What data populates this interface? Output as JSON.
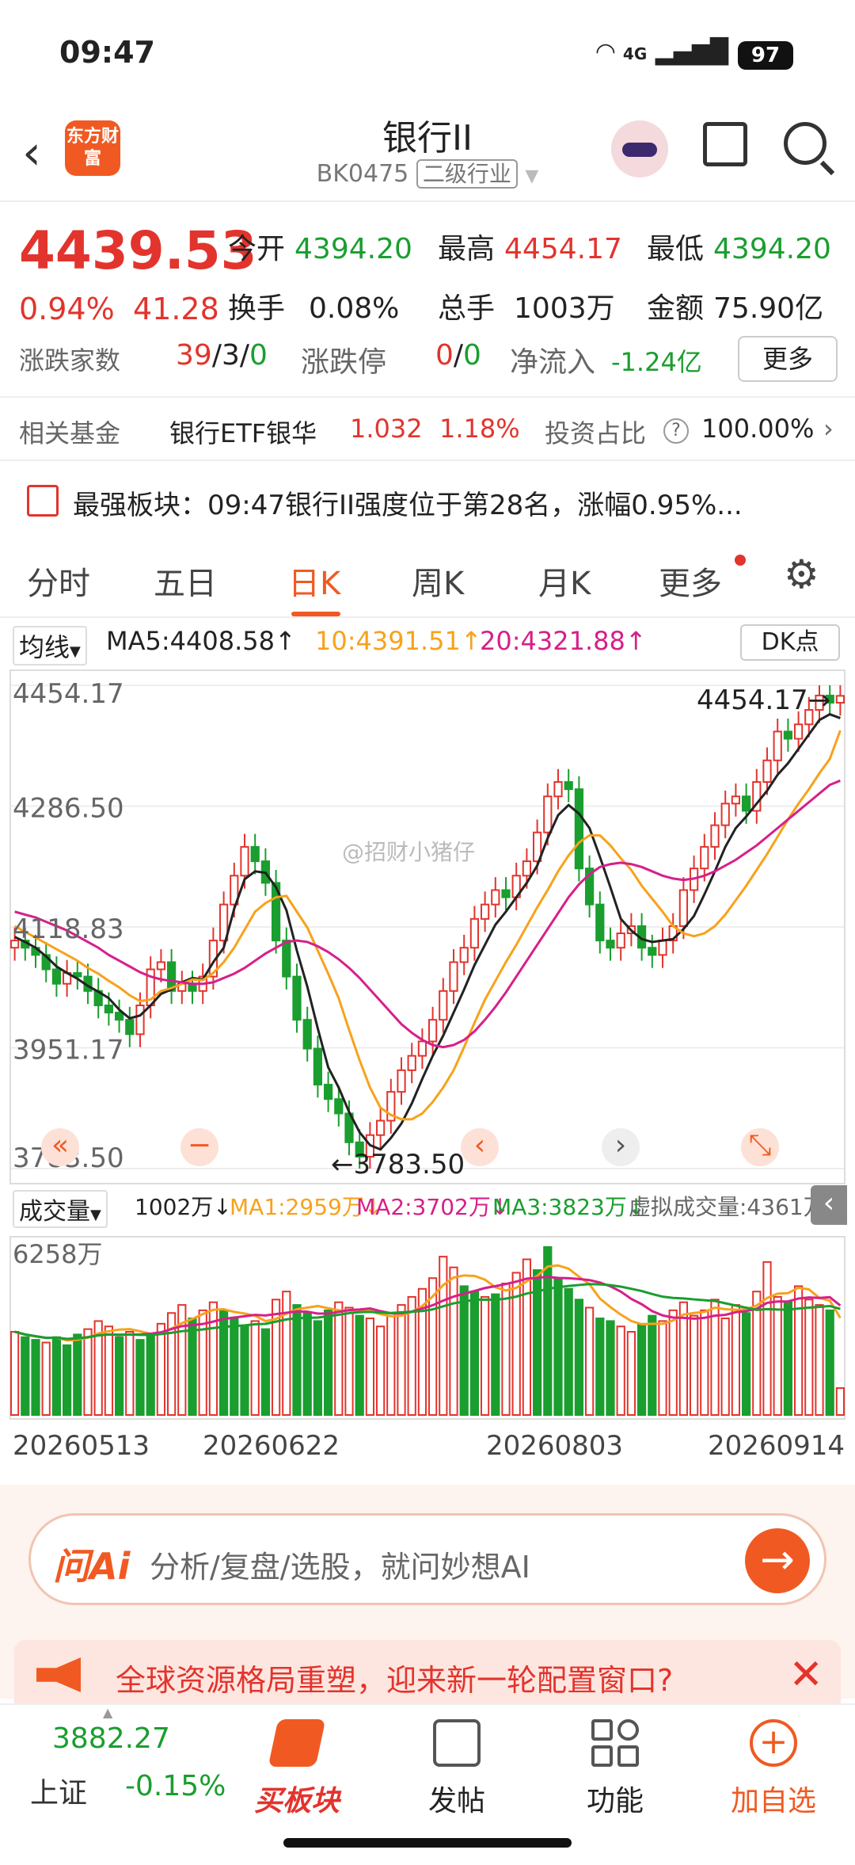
{
  "status": {
    "time": "09:47",
    "network": "4G",
    "battery": "97"
  },
  "header": {
    "title": "银行II",
    "code": "BK0475",
    "category": "二级行业",
    "logo": "东方财富"
  },
  "quote": {
    "price": "4439.53",
    "pct": "0.94%",
    "chg": "41.28",
    "open_label": "今开",
    "open": "4394.20",
    "high_label": "最高",
    "high": "4454.17",
    "low_label": "最低",
    "low": "4394.20",
    "turnover_label": "换手",
    "turnover": "0.08%",
    "volume_label": "总手",
    "volume": "1003万",
    "amount_label": "金额",
    "amount": "75.90亿",
    "breadth_label": "涨跌家数",
    "up": "39",
    "flat": "3",
    "down": "0",
    "limit_label": "涨跌停",
    "limit_up": "0",
    "limit_down": "0",
    "inflow_label": "净流入",
    "inflow": "-1.24亿",
    "more": "更多"
  },
  "fund": {
    "label": "相关基金",
    "name": "银行ETF银华",
    "price": "1.032",
    "pct": "1.18%",
    "ratio_label": "投资占比",
    "ratio": "100.00%"
  },
  "strong": {
    "label": "最强板块：",
    "text": "09:47银行II强度位于第28名，涨幅0.95%..."
  },
  "tabs": [
    "分时",
    "五日",
    "日K",
    "周K",
    "月K",
    "更多"
  ],
  "ma": {
    "selector": "均线",
    "ma5": "MA5:4408.58↑",
    "ma10": "10:4391.51↑",
    "ma20": "20:4321.88↑",
    "dk": "DK点"
  },
  "chart_data": [
    {
      "type": "candlestick",
      "title": "",
      "yticks": [
        "4454.17",
        "4286.50",
        "4118.83",
        "3951.17",
        "3783.50"
      ],
      "ylim": [
        3783.5,
        4454.17
      ],
      "max_label": "4454.17",
      "min_label": "3783.50",
      "x_ticks": [
        "20260513",
        "20260622",
        "20260803",
        "20260914"
      ],
      "close": [
        4100,
        4090,
        4080,
        4060,
        4040,
        4055,
        4050,
        4030,
        4010,
        4000,
        3990,
        3970,
        4010,
        4060,
        4070,
        4030,
        4040,
        4030,
        4050,
        4100,
        4150,
        4190,
        4230,
        4210,
        4180,
        4100,
        4050,
        3990,
        3950,
        3900,
        3880,
        3860,
        3820,
        3800,
        3830,
        3850,
        3890,
        3920,
        3940,
        3960,
        3990,
        4030,
        4070,
        4090,
        4130,
        4150,
        4170,
        4160,
        4190,
        4210,
        4250,
        4300,
        4320,
        4310,
        4200,
        4150,
        4100,
        4090,
        4110,
        4120,
        4090,
        4080,
        4100,
        4120,
        4170,
        4200,
        4230,
        4260,
        4290,
        4300,
        4280,
        4320,
        4350,
        4390,
        4380,
        4400,
        4420,
        4440,
        4430,
        4439.53
      ],
      "ma5": [
        4105,
        4098,
        4090,
        4078,
        4064,
        4055,
        4047,
        4037,
        4029,
        4020,
        4004,
        3992,
        3996,
        4010,
        4026,
        4032,
        4042,
        4048,
        4046,
        4070,
        4090,
        4144,
        4185,
        4196,
        4194,
        4174,
        4142,
        4086,
        4036,
        3978,
        3924,
        3896,
        3862,
        3834,
        3816,
        3810,
        3826,
        3846,
        3874,
        3908,
        3940,
        3968,
        4000,
        4032,
        4066,
        4094,
        4122,
        4140,
        4160,
        4180,
        4204,
        4242,
        4274,
        4288,
        4276,
        4256,
        4216,
        4174,
        4130,
        4114,
        4102,
        4098,
        4100,
        4102,
        4116,
        4134,
        4164,
        4196,
        4230,
        4256,
        4272,
        4290,
        4308,
        4330,
        4346,
        4366,
        4386,
        4406,
        4414,
        4408.58
      ],
      "ma10": [
        4120,
        4112,
        4104,
        4096,
        4088,
        4080,
        4072,
        4062,
        4054,
        4044,
        4035,
        4024,
        4016,
        4018,
        4030,
        4034,
        4040,
        4046,
        4045,
        4055,
        4070,
        4090,
        4115,
        4140,
        4152,
        4160,
        4162,
        4140,
        4118,
        4086,
        4054,
        4020,
        3976,
        3934,
        3896,
        3868,
        3858,
        3852,
        3852,
        3860,
        3876,
        3896,
        3920,
        3952,
        3986,
        4018,
        4044,
        4070,
        4094,
        4120,
        4146,
        4170,
        4196,
        4218,
        4236,
        4246,
        4246,
        4232,
        4214,
        4198,
        4176,
        4158,
        4140,
        4120,
        4110,
        4106,
        4110,
        4120,
        4136,
        4156,
        4176,
        4198,
        4220,
        4244,
        4268,
        4290,
        4310,
        4332,
        4352,
        4391.51
      ],
      "ma20": [
        4140,
        4136,
        4132,
        4126,
        4120,
        4114,
        4106,
        4098,
        4090,
        4080,
        4072,
        4064,
        4056,
        4050,
        4046,
        4044,
        4042,
        4040,
        4040,
        4042,
        4048,
        4054,
        4062,
        4072,
        4082,
        4090,
        4098,
        4100,
        4098,
        4092,
        4084,
        4074,
        4062,
        4048,
        4032,
        4016,
        4000,
        3984,
        3972,
        3962,
        3955,
        3952,
        3955,
        3962,
        3974,
        3990,
        4008,
        4028,
        4050,
        4072,
        4094,
        4116,
        4138,
        4160,
        4178,
        4192,
        4202,
        4206,
        4208,
        4206,
        4202,
        4196,
        4190,
        4186,
        4184,
        4186,
        4190,
        4196,
        4204,
        4212,
        4222,
        4232,
        4244,
        4256,
        4268,
        4280,
        4292,
        4304,
        4316,
        4321.88
      ]
    },
    {
      "type": "bar",
      "title": "",
      "max_label": "6258万",
      "ylim": [
        0,
        6258
      ],
      "values": [
        3100,
        2900,
        2800,
        2700,
        2900,
        2600,
        3000,
        3200,
        3500,
        3300,
        2900,
        3100,
        2800,
        3000,
        3400,
        3800,
        4100,
        3600,
        3900,
        4200,
        3900,
        3600,
        3300,
        3500,
        3200,
        4300,
        4600,
        4100,
        3800,
        3500,
        3900,
        4200,
        4000,
        3700,
        3600,
        3300,
        3800,
        4100,
        4400,
        4700,
        5100,
        5900,
        5500,
        4800,
        4600,
        4400,
        4500,
        4900,
        5300,
        5800,
        5400,
        6258,
        5100,
        4700,
        4300,
        4000,
        3600,
        3500,
        3300,
        3100,
        3400,
        3700,
        3500,
        3900,
        4200,
        3700,
        3900,
        4300,
        3600,
        4100,
        3800,
        4600,
        5700,
        4400,
        4200,
        4800,
        4300,
        4100,
        3900,
        1002
      ],
      "up": [
        1,
        0,
        0,
        1,
        0,
        0,
        0,
        1,
        1,
        1,
        0,
        1,
        0,
        0,
        1,
        1,
        1,
        0,
        1,
        1,
        0,
        0,
        0,
        1,
        0,
        1,
        1,
        0,
        0,
        0,
        0,
        1,
        1,
        0,
        1,
        1,
        1,
        1,
        1,
        1,
        1,
        1,
        1,
        0,
        0,
        1,
        0,
        1,
        1,
        1,
        0,
        0,
        0,
        0,
        0,
        1,
        0,
        0,
        1,
        1,
        0,
        0,
        1,
        1,
        1,
        1,
        1,
        1,
        1,
        1,
        0,
        1,
        1,
        1,
        0,
        1,
        1,
        1,
        0,
        1
      ]
    }
  ],
  "vol": {
    "selector": "成交量",
    "now": "1002万↓",
    "ma1": "MA1:2959万↓",
    "ma2": "MA2:3702万↓",
    "ma3": "MA3:3823万↓",
    "virtual": "虚拟成交量:4361万"
  },
  "watermark": "@招财小猪仔",
  "ai": {
    "logo": "问Ai",
    "placeholder": "分析/复盘/选股，就问妙想AI"
  },
  "banner": {
    "text": "全球资源格局重塑，迎来新一轮配置窗口?"
  },
  "bottom": {
    "index_value": "3882.27",
    "index_name": "上证",
    "index_chg": "-0.15%",
    "nav": [
      "买板块",
      "发帖",
      "功能",
      "加自选"
    ]
  }
}
